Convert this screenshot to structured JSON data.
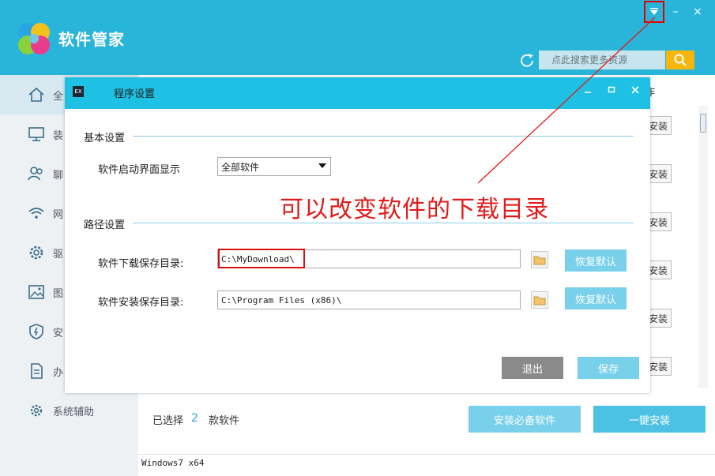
{
  "app": {
    "title": "软件管家"
  },
  "header": {
    "search_placeholder": "点此搜索更多资源",
    "window_controls": {
      "menu": "▼",
      "minimize": "–",
      "close": "×"
    }
  },
  "sidebar": {
    "items": [
      {
        "label": "全",
        "icon": "home-icon"
      },
      {
        "label": "装",
        "icon": "monitor-icon"
      },
      {
        "label": "聊",
        "icon": "users-icon"
      },
      {
        "label": "网",
        "icon": "wifi-icon"
      },
      {
        "label": "驱",
        "icon": "gear-icon"
      },
      {
        "label": "图",
        "icon": "image-icon"
      },
      {
        "label": "安",
        "icon": "shield-icon"
      },
      {
        "label": "办",
        "icon": "document-icon"
      },
      {
        "label": "系统辅助",
        "icon": "settings-icon"
      }
    ]
  },
  "main": {
    "column_header_cut": "作",
    "install_label": "安装",
    "selected_label": "已选择",
    "selected_count": "2",
    "selected_unit": "款软件",
    "install_essentials": "安装必备软件",
    "one_click_install": "一键安装",
    "os_label": "Windows7 x64"
  },
  "dialog": {
    "title": "程序设置",
    "icon_text": "EX",
    "basic_section": "基本设置",
    "startup_label": "软件启动界面显示",
    "startup_value": "全部软件",
    "path_section": "路径设置",
    "download_label": "软件下载保存目录:",
    "download_path": "C:\\MyDownload\\",
    "install_label": "软件安装保存目录:",
    "install_path": "C:\\Program Files (x86)\\",
    "restore_default": "恢复默认",
    "exit": "退出",
    "save": "保存"
  },
  "annotation": {
    "text": "可以改变软件的下载目录",
    "color": "#e11b1b"
  },
  "colors": {
    "header_bg": "#29b5da",
    "dialog_titlebar": "#1ec0e4",
    "accent_button": "#79d0ea",
    "search_button": "#f7b60d"
  }
}
